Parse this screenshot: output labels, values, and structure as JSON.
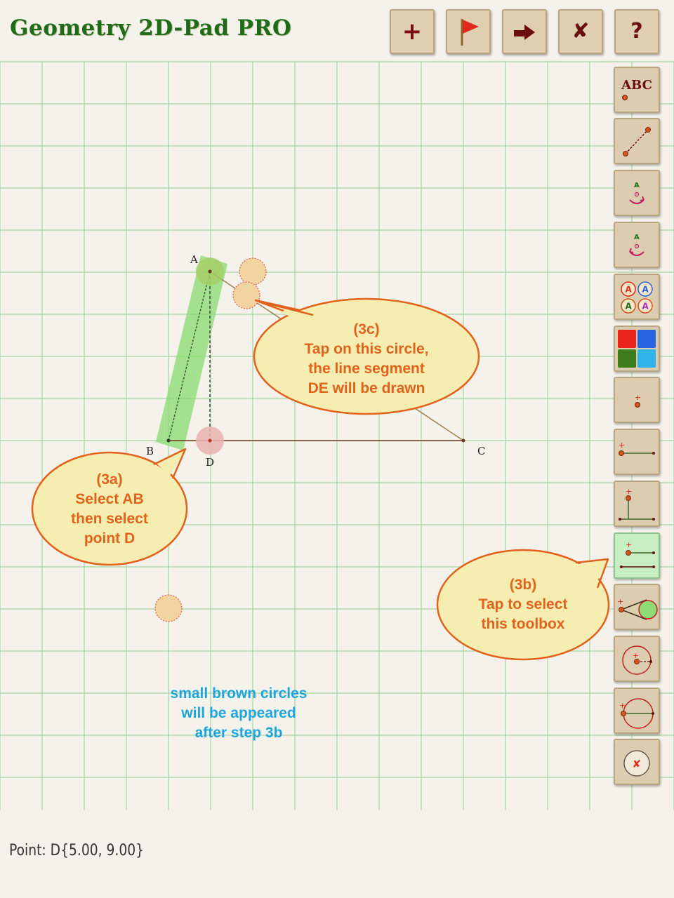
{
  "app": {
    "title": "Geometry 2D-Pad PRO"
  },
  "toolbar": {
    "buttons": [
      {
        "name": "add-button",
        "icon": "plus-icon"
      },
      {
        "name": "flag-button",
        "icon": "flag-icon"
      },
      {
        "name": "redo-button",
        "icon": "arrow-right-icon"
      },
      {
        "name": "clear-button",
        "icon": "x-icon"
      },
      {
        "name": "help-button",
        "icon": "question-icon"
      }
    ],
    "add_glyph": "+",
    "clear_glyph": "✘",
    "help_glyph": "?"
  },
  "side_tools": {
    "label_tool_text": "ABC",
    "tools": [
      {
        "name": "label-tool",
        "icon": "abc-label-icon"
      },
      {
        "name": "segment-tool",
        "icon": "dashed-segment-icon"
      },
      {
        "name": "rotate-ccw-tool",
        "icon": "rotate-ccw-icon"
      },
      {
        "name": "rotate-cw-tool",
        "icon": "rotate-cw-icon"
      },
      {
        "name": "label-style-tool",
        "icon": "label-style-icon"
      },
      {
        "name": "color-tool",
        "icon": "color-palette-icon"
      },
      {
        "name": "point-tool",
        "icon": "point-icon"
      },
      {
        "name": "line-tool",
        "icon": "line-icon"
      },
      {
        "name": "perpendicular-tool",
        "icon": "perpendicular-icon"
      },
      {
        "name": "parallel-tool",
        "icon": "parallel-icon",
        "active": true
      },
      {
        "name": "tangent-tool",
        "icon": "tangent-icon"
      },
      {
        "name": "circle-radius-tool",
        "icon": "circle-radius-icon"
      },
      {
        "name": "circle-diameter-tool",
        "icon": "circle-diameter-icon"
      },
      {
        "name": "delete-tool",
        "icon": "delete-icon"
      }
    ],
    "palette_colors": [
      "#e8241c",
      "#2a63e0",
      "#3d7d1c",
      "#2fb3e8"
    ]
  },
  "geometry": {
    "points": [
      {
        "label": "A"
      },
      {
        "label": "B"
      },
      {
        "label": "C"
      },
      {
        "label": "D"
      }
    ]
  },
  "callouts": {
    "step_3a": {
      "lines": [
        "(3a)",
        "Select AB",
        "then select",
        "point D"
      ]
    },
    "step_3b": {
      "lines": [
        "(3b)",
        "Tap to select",
        "this toolbox"
      ]
    },
    "step_3c": {
      "lines": [
        "(3c)",
        "Tap on this circle,",
        "the line segment",
        "DE will be drawn"
      ]
    }
  },
  "hint": {
    "lines": [
      "small brown circles",
      "will be appeared",
      "after step 3b"
    ]
  },
  "status": {
    "text": "Point: D{5.00, 9.00}"
  },
  "colors": {
    "grid_major": "#a8d4a3",
    "grid_minor": "#d5ebd2",
    "callout_fill": "#f6eeb0",
    "callout_stroke": "#e1621c",
    "callout_text": "#e1621c",
    "hint_text": "#1ea7df",
    "selection_highlight": "#8fdc77",
    "candidate_circle": "#f2d4a0",
    "active_tool": "#c8eec4"
  }
}
